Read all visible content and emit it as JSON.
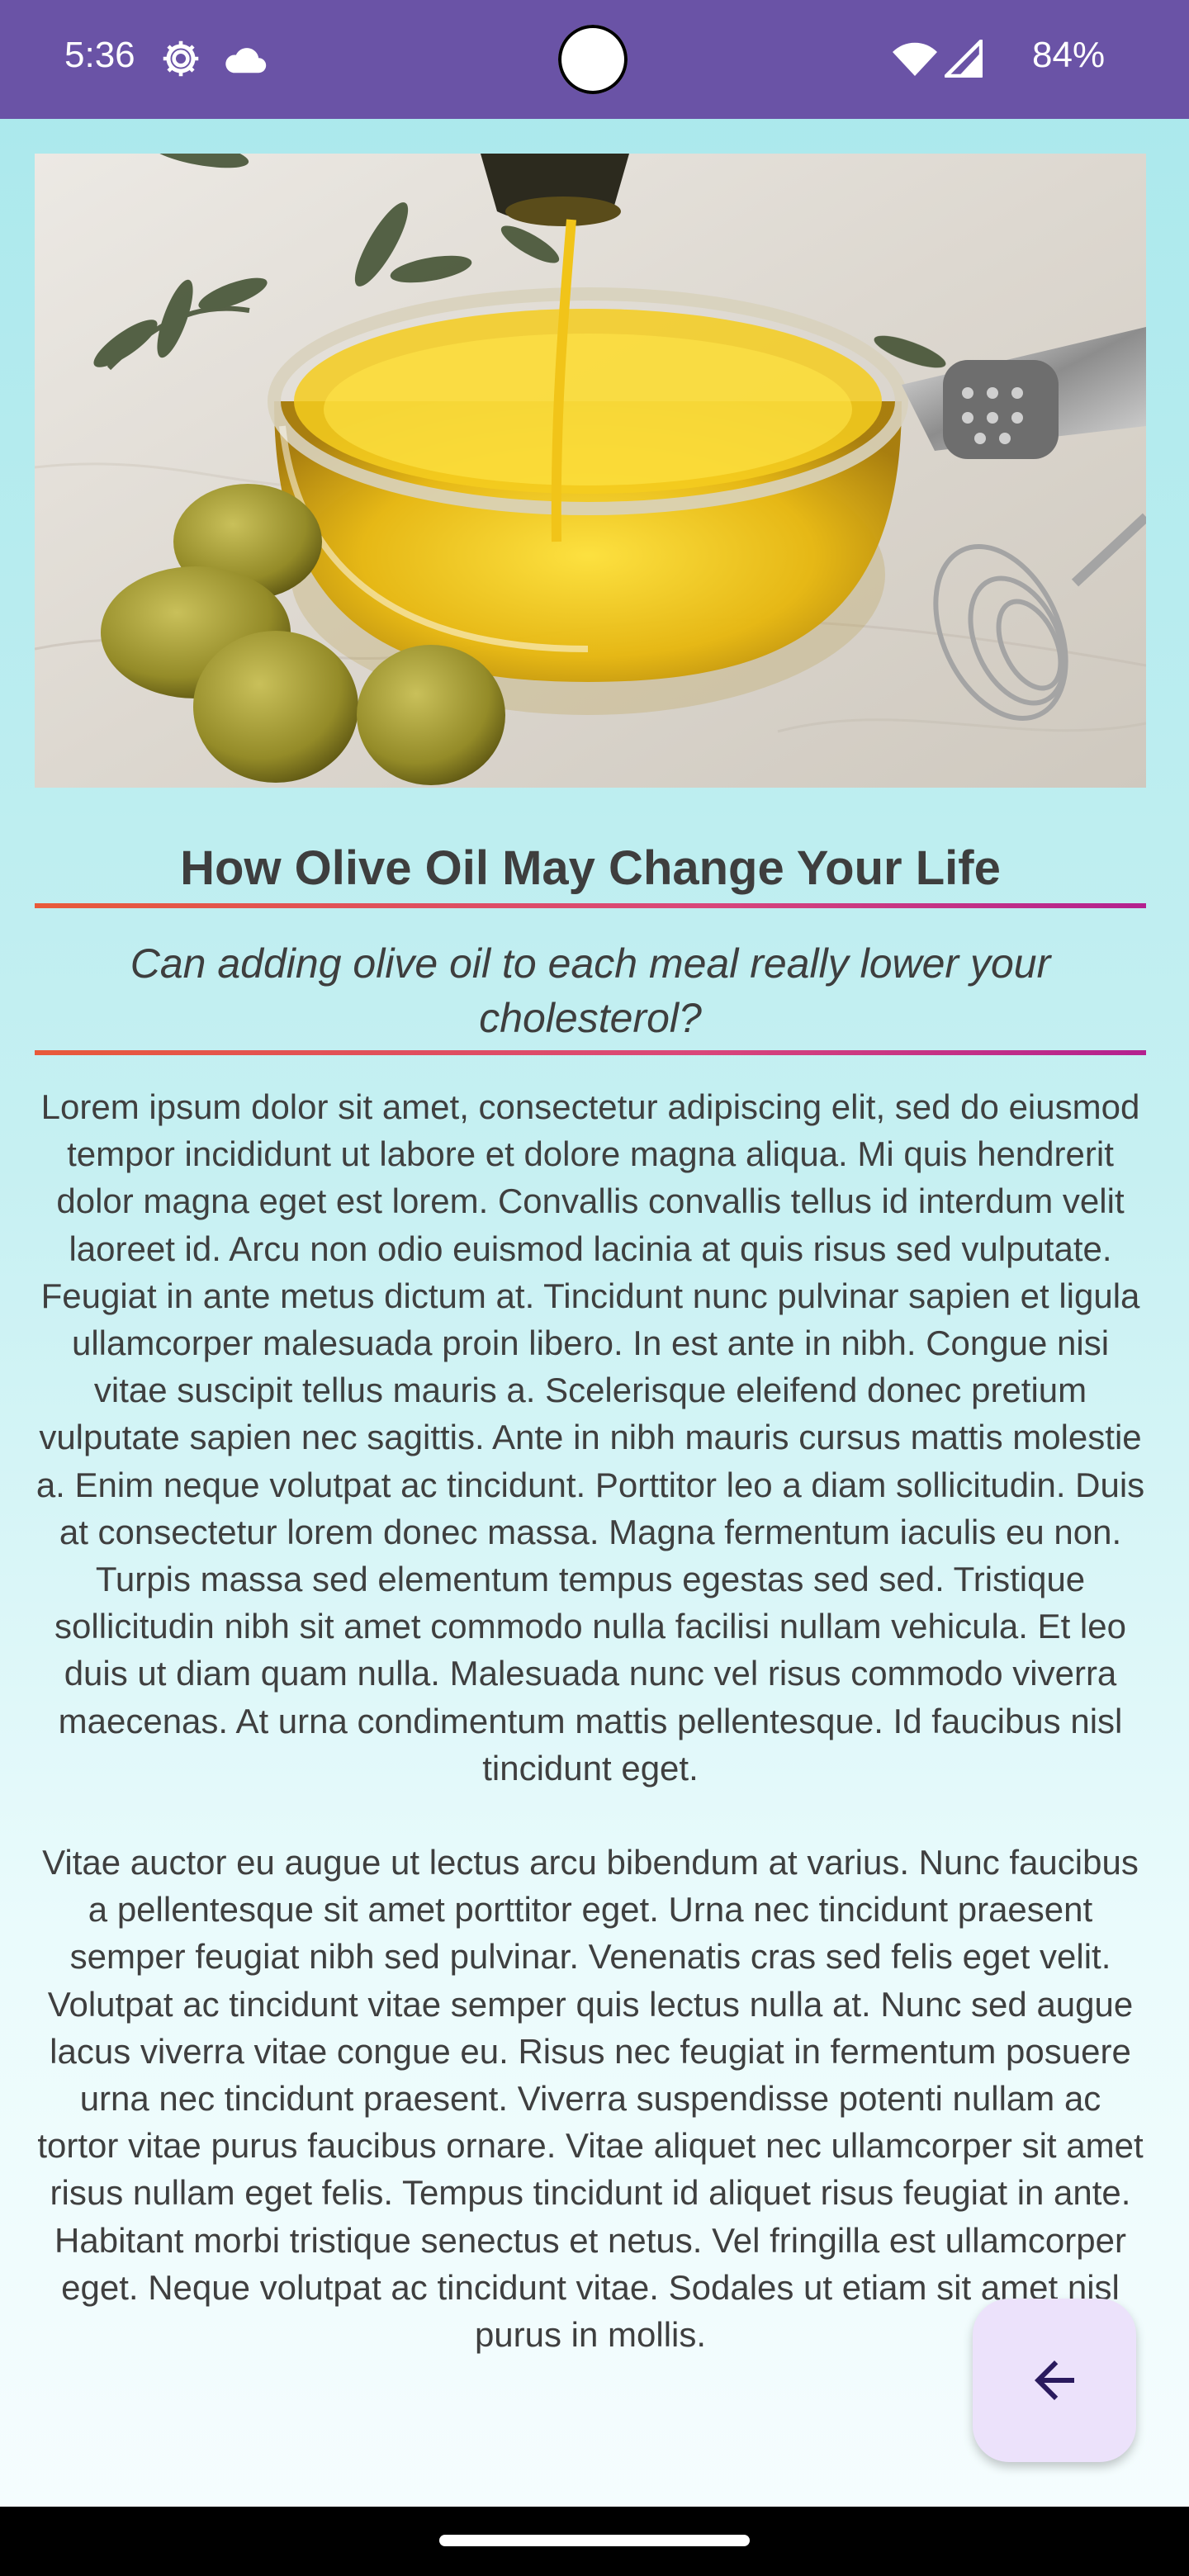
{
  "status_bar": {
    "time": "5:36",
    "battery": "84%",
    "background": "#6a53a6",
    "icons": [
      "gear-icon",
      "cloud-icon",
      "wifi-icon",
      "signal-icon"
    ]
  },
  "article": {
    "hero_image": "olive-oil-bowl-photo",
    "title": "How Olive Oil May Change Your Life",
    "subtitle": "Can adding olive oil to each meal really lower your cholesterol?",
    "paragraphs": [
      "Lorem ipsum dolor sit amet, consectetur adipiscing elit, sed do eiusmod tempor incididunt ut labore et dolore magna aliqua. Mi quis hendrerit dolor magna eget est lorem. Convallis convallis tellus id interdum velit laoreet id. Arcu non odio euismod lacinia at quis risus sed vulputate. Feugiat in ante metus dictum at. Tincidunt nunc pulvinar sapien et ligula ullamcorper malesuada proin libero. In est ante in nibh. Congue nisi vitae suscipit tellus mauris a. Scelerisque eleifend donec pretium vulputate sapien nec sagittis. Ante in nibh mauris cursus mattis molestie a. Enim neque volutpat ac tincidunt. Porttitor leo a diam sollicitudin. Duis at consectetur lorem donec massa. Magna fermentum iaculis eu non. Turpis massa sed elementum tempus egestas sed sed. Tristique sollicitudin nibh sit amet commodo nulla facilisi nullam vehicula. Et leo duis ut diam quam nulla. Malesuada nunc vel risus commodo viverra maecenas. At urna condimentum mattis pellentesque. Id faucibus nisl tincidunt eget.",
      "Vitae auctor eu augue ut lectus arcu bibendum at varius. Nunc faucibus a pellentesque sit amet porttitor eget. Urna nec tincidunt praesent semper feugiat nibh sed pulvinar. Venenatis cras sed felis eget velit. Volutpat ac tincidunt vitae semper quis lectus nulla at. Nunc sed augue lacus viverra vitae congue eu. Risus nec feugiat in fermentum posuere urna nec tincidunt praesent. Viverra suspendisse potenti nullam ac tortor vitae purus faucibus ornare. Vitae aliquet nec ullamcorper sit amet risus nullam eget felis. Tempus tincidunt id aliquet risus feugiat in ante. Habitant morbi tristique senectus et netus. Vel fringilla est ullamcorper eget. Neque volutpat ac tincidunt vitae. Sodales ut etiam sit amet nisl purus in mollis."
    ]
  },
  "fab": {
    "icon": "arrow-back-icon",
    "background": "#ece2fb"
  },
  "colors": {
    "divider_start": "#e85a3a",
    "divider_end": "#b3218f",
    "text": "#3e3e3e"
  }
}
